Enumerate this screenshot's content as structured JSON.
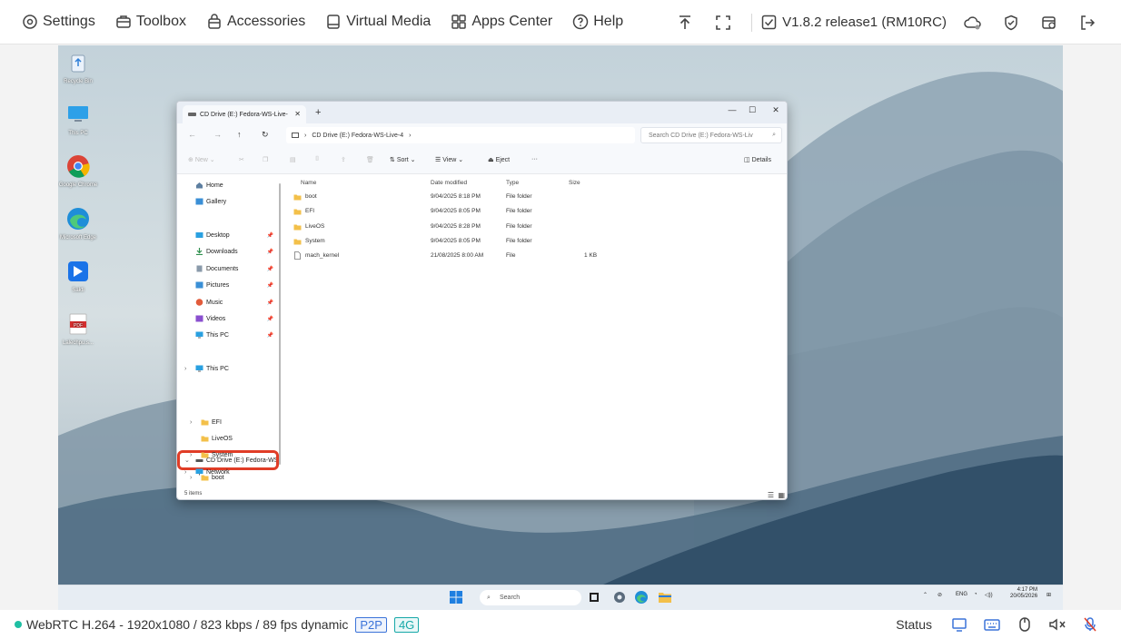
{
  "kvm_menu": [
    {
      "label": "Settings",
      "icon": "gear-icon"
    },
    {
      "label": "Toolbox",
      "icon": "toolbox-icon"
    },
    {
      "label": "Accessories",
      "icon": "bag-icon"
    },
    {
      "label": "Virtual Media",
      "icon": "disk-icon"
    },
    {
      "label": "Apps Center",
      "icon": "grid-icon"
    },
    {
      "label": "Help",
      "icon": "help-icon"
    }
  ],
  "kvm_version": "V1.8.2 release1 (RM10RC)",
  "desktop_icons": [
    {
      "label": "Recycle Bin",
      "icon": "recycle-bin-icon"
    },
    {
      "label": "This PC",
      "icon": "monitor-icon"
    },
    {
      "label": "Google Chrome",
      "icon": "chrome-icon"
    },
    {
      "label": "Microsoft Edge",
      "icon": "edge-icon"
    },
    {
      "label": "Sakti",
      "icon": "app-icon"
    },
    {
      "label": "Lalechpu.s...",
      "icon": "pdf-icon"
    }
  ],
  "explorer": {
    "tab_title": "CD Drive (E:) Fedora-WS-Live-",
    "breadcrumb": "CD Drive (E:) Fedora-WS-Live-4",
    "search_placeholder": "Search CD Drive (E:) Fedora-WS-Liv",
    "cmd": {
      "new": "New",
      "sort": "Sort",
      "view": "View",
      "eject": "Eject",
      "more": "···",
      "details": "Details"
    },
    "quick": [
      {
        "label": "Home",
        "pinned": false
      },
      {
        "label": "Gallery",
        "pinned": false
      },
      {
        "label": "Desktop",
        "pinned": true
      },
      {
        "label": "Downloads",
        "pinned": true
      },
      {
        "label": "Documents",
        "pinned": true
      },
      {
        "label": "Pictures",
        "pinned": true
      },
      {
        "label": "Music",
        "pinned": true
      },
      {
        "label": "Videos",
        "pinned": true
      },
      {
        "label": "This PC",
        "pinned": true
      }
    ],
    "tree": [
      {
        "label": "This PC",
        "chev": "›"
      },
      {
        "label": "CD Drive (E:) Fedora-WS",
        "chev": "⌄",
        "selected": true
      },
      {
        "label": "boot",
        "chev": "›"
      },
      {
        "label": "EFI",
        "chev": "›"
      },
      {
        "label": "LiveOS",
        "chev": ""
      },
      {
        "label": "System",
        "chev": "›"
      },
      {
        "label": "Network",
        "chev": "›"
      }
    ],
    "columns": {
      "name": "Name",
      "date": "Date modified",
      "type": "Type",
      "size": "Size"
    },
    "files": [
      {
        "name": "boot",
        "date": "9/04/2025 8:18 PM",
        "type": "File folder",
        "size": "",
        "kind": "folder"
      },
      {
        "name": "EFI",
        "date": "9/04/2025 8:05 PM",
        "type": "File folder",
        "size": "",
        "kind": "folder"
      },
      {
        "name": "LiveOS",
        "date": "9/04/2025 8:28 PM",
        "type": "File folder",
        "size": "",
        "kind": "folder"
      },
      {
        "name": "System",
        "date": "9/04/2025 8:05 PM",
        "type": "File folder",
        "size": "",
        "kind": "folder"
      },
      {
        "name": "mach_kernel",
        "date": "21/08/2025 8:00 AM",
        "type": "File",
        "size": "1 KB",
        "kind": "file"
      }
    ],
    "status": "5 items"
  },
  "taskbar": {
    "search_placeholder": "Search",
    "tray_lang": "ENG",
    "clock_time": "4:17 PM",
    "clock_date": "20/05/2026"
  },
  "status_strip": {
    "stream": "WebRTC H.264 - 1920x1080 /  823 kbps / 89 fps dynamic",
    "chip_p2p": "P2P",
    "chip_4g": "4G",
    "status_label": "Status"
  },
  "colors": {
    "highlight_ring": "#e03d27",
    "stream_dot": "#1fbfa3",
    "p2p": "#3b73d9",
    "g4": "#16a8a8"
  }
}
